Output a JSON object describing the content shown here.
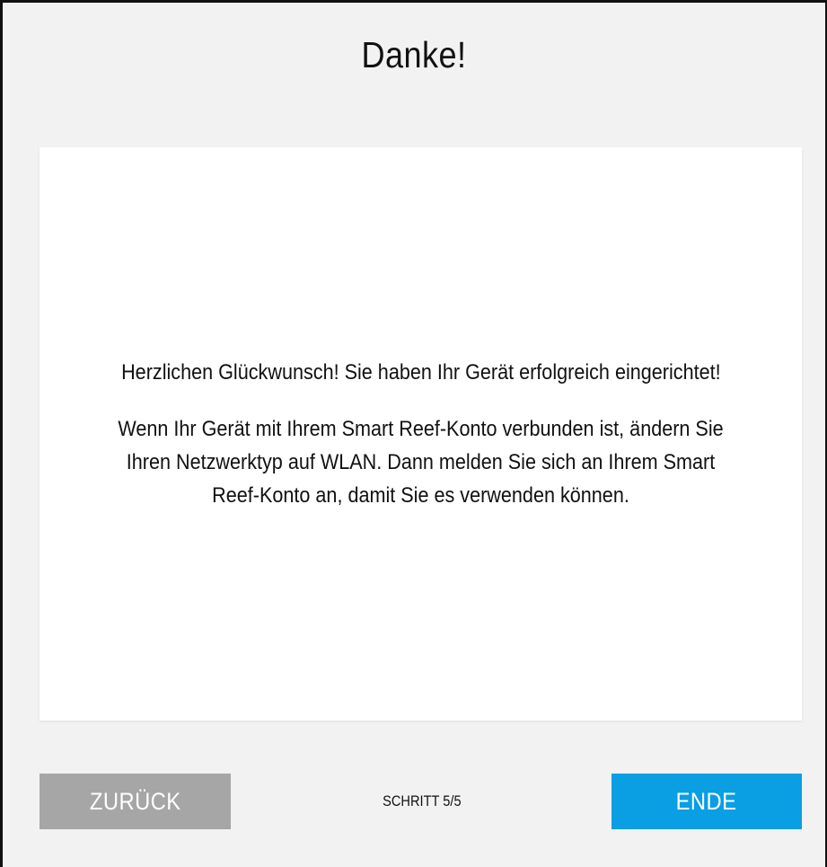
{
  "dialog": {
    "title": "Danke!"
  },
  "message": {
    "paragraph1": "Herzlichen Glückwunsch! Sie haben Ihr Gerät erfolgreich eingerichtet!",
    "paragraph2": "Wenn Ihr Gerät mit Ihrem Smart Reef-Konto verbunden ist, ändern Sie Ihren Netzwerktyp auf WLAN. Dann melden Sie sich an Ihrem Smart Reef-Konto an, damit Sie es verwenden können."
  },
  "footer": {
    "back_label": "ZURÜCK",
    "step_label": "SCHRITT 5/5",
    "end_label": "ENDE"
  },
  "colors": {
    "background": "#f2f2f2",
    "card": "#ffffff",
    "back_button": "#a6a6a6",
    "end_button": "#0a9ee3",
    "text": "#111111"
  }
}
